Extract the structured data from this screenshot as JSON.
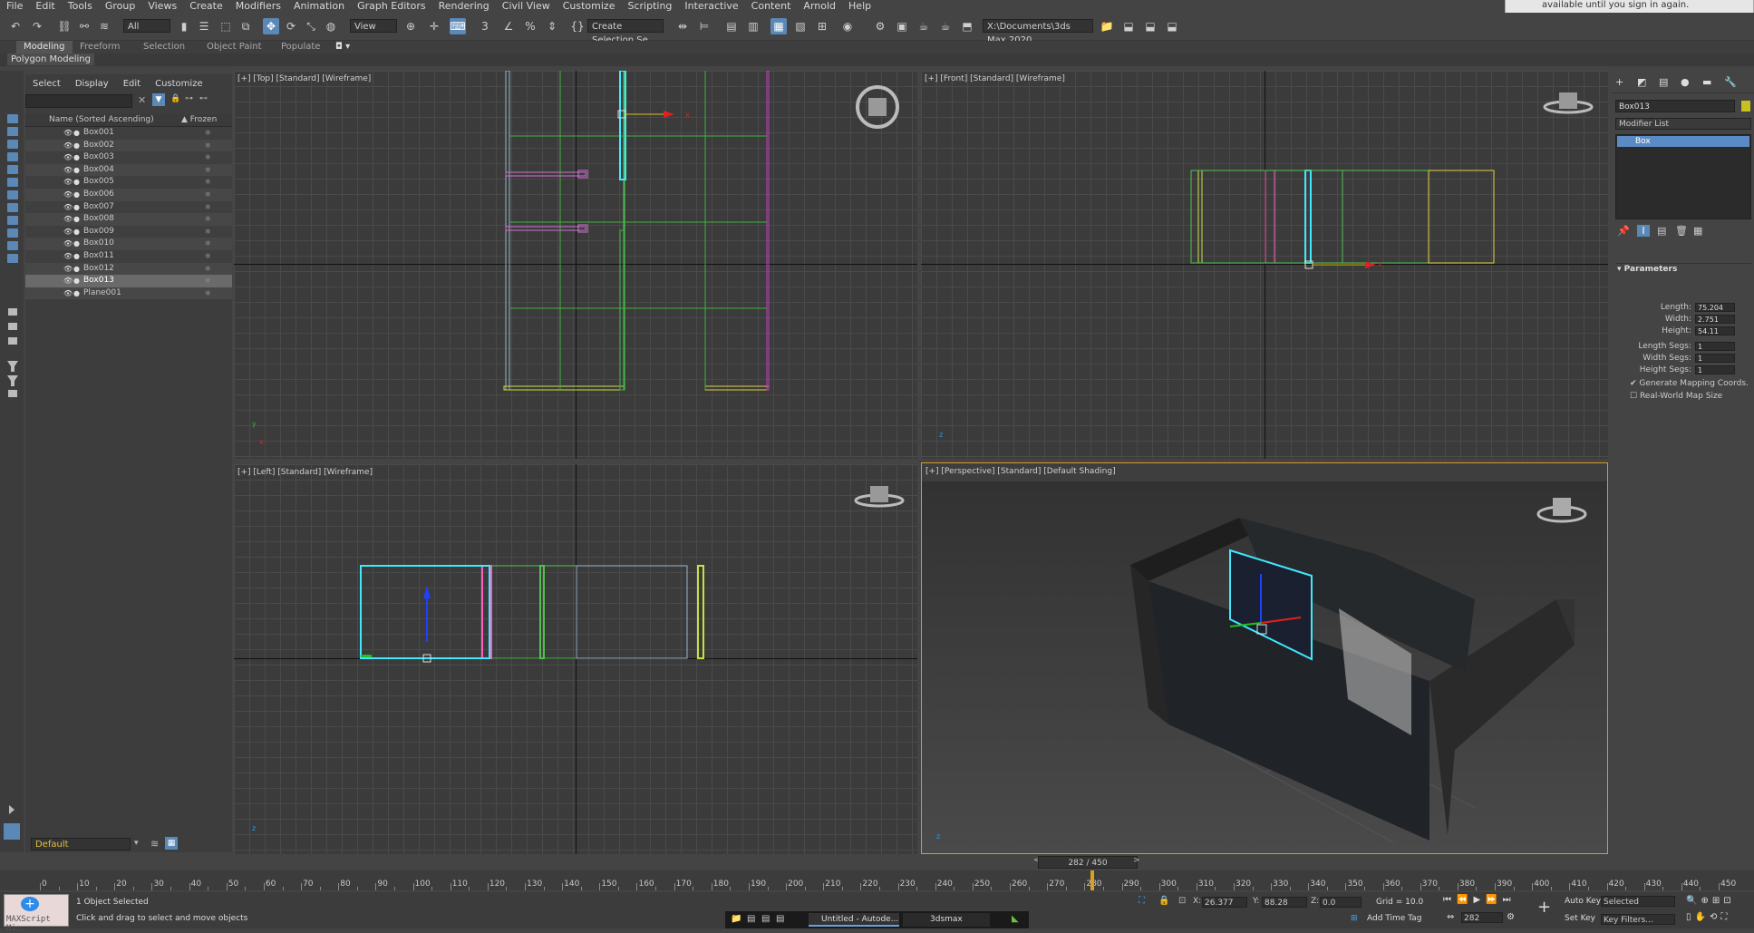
{
  "menu": [
    "File",
    "Edit",
    "Tools",
    "Group",
    "Views",
    "Create",
    "Modifiers",
    "Animation",
    "Graph Editors",
    "Rendering",
    "Civil View",
    "Customize",
    "Scripting",
    "Interactive",
    "Content",
    "Arnold",
    "Help"
  ],
  "notification": "available until you sign in again.",
  "toolbar": {
    "selection_filter": "All",
    "ref_coord": "View",
    "named_selection": "Create Selection Se",
    "project_path": "X:\\Documents\\3ds Max 2020"
  },
  "ribbon": {
    "tabs": [
      "Modeling",
      "Freeform",
      "Selection",
      "Object Paint",
      "Populate"
    ],
    "active_tab": "Modeling",
    "panel": "Polygon Modeling"
  },
  "explorer": {
    "menu": [
      "Select",
      "Display",
      "Edit",
      "Customize"
    ],
    "col_name": "Name (Sorted Ascending)",
    "col_frozen": "▲ Frozen",
    "items": [
      {
        "name": "Box001"
      },
      {
        "name": "Box002"
      },
      {
        "name": "Box003"
      },
      {
        "name": "Box004"
      },
      {
        "name": "Box005"
      },
      {
        "name": "Box006"
      },
      {
        "name": "Box007"
      },
      {
        "name": "Box008"
      },
      {
        "name": "Box009"
      },
      {
        "name": "Box010"
      },
      {
        "name": "Box011"
      },
      {
        "name": "Box012"
      },
      {
        "name": "Box013",
        "selected": true
      },
      {
        "name": "Plane001"
      }
    ],
    "layer": "Default"
  },
  "viewports": {
    "top": "[+] [Top] [Standard] [Wireframe]",
    "front": "[+] [Front] [Standard] [Wireframe]",
    "left": "[+] [Left] [Standard] [Wireframe]",
    "persp": "[+] [Perspective] [Standard] [Default Shading]"
  },
  "command_panel": {
    "object_name": "Box013",
    "object_color": "#c8c020",
    "modifier_list": "Modifier List",
    "stack_item": "Box",
    "params_title": "Parameters",
    "params": [
      {
        "label": "Length:",
        "value": "75.204"
      },
      {
        "label": "Width:",
        "value": "2.751"
      },
      {
        "label": "Height:",
        "value": "54.11"
      },
      {
        "label": "Length Segs:",
        "value": "1"
      },
      {
        "label": "Width Segs:",
        "value": "1"
      },
      {
        "label": "Height Segs:",
        "value": "1"
      }
    ],
    "gen_mapping": "Generate Mapping Coords.",
    "real_world": "Real-World Map Size"
  },
  "timeline": {
    "slider": "282 / 450",
    "current": 282,
    "max": 450,
    "labels": [
      "0",
      "10",
      "20",
      "30",
      "40",
      "50",
      "60",
      "70",
      "80",
      "90",
      "100",
      "110",
      "120",
      "130",
      "140",
      "150",
      "160",
      "170",
      "180",
      "190",
      "200",
      "210",
      "220",
      "230",
      "240",
      "250",
      "260",
      "270",
      "280",
      "290",
      "300",
      "310",
      "320",
      "330",
      "340",
      "350",
      "360",
      "370",
      "380",
      "390",
      "400",
      "410",
      "420",
      "430",
      "440",
      "450"
    ]
  },
  "status": {
    "maxscript": "MAXScript Mi:",
    "selected": "1 Object Selected",
    "prompt": "Click and drag to select and move objects",
    "x_label": "X:",
    "x": "26.377",
    "y_label": "Y:",
    "y": "88.28",
    "z_label": "Z:",
    "z": "0.0",
    "grid": "Grid = 10.0",
    "add_time_tag": "Add Time Tag",
    "auto_key": "Auto Key",
    "set_key": "Set Key",
    "key_mode": "Selected",
    "key_filters": "Key Filters...",
    "frame": "282"
  },
  "taskbar": [
    "Untitled - Autode...",
    "3dsmax"
  ]
}
